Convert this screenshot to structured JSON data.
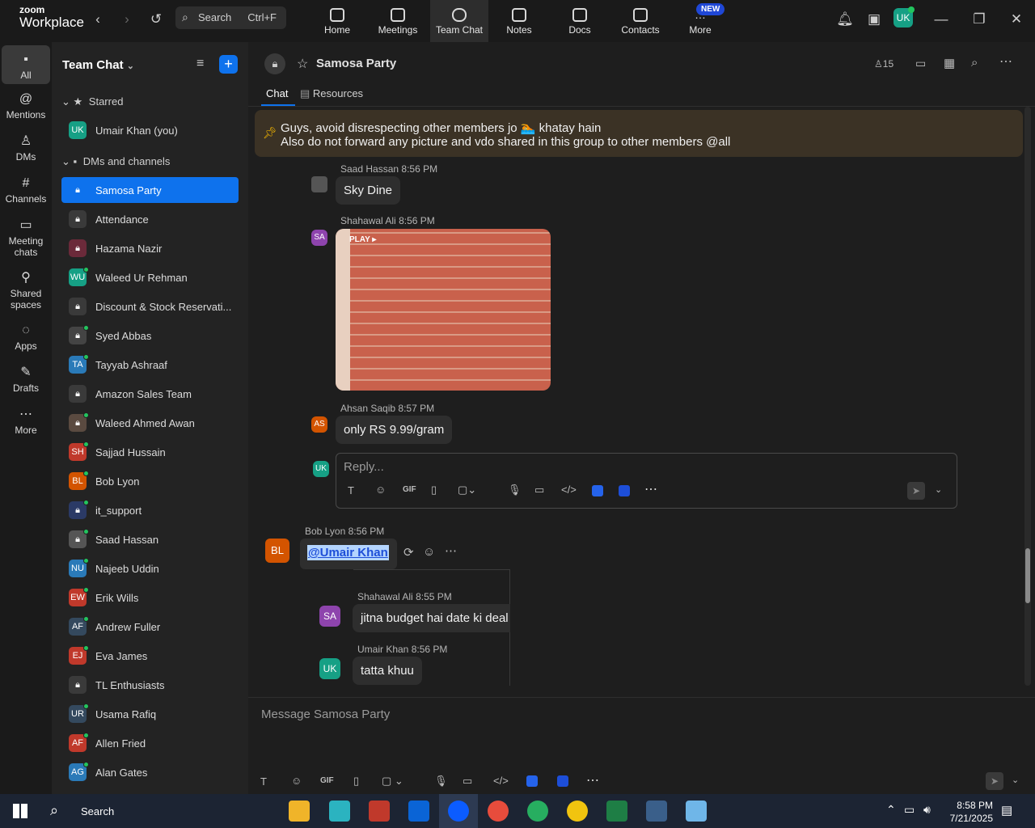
{
  "app": {
    "logo_top": "zoom",
    "logo_bottom": "Workplace"
  },
  "search": {
    "label": "Search",
    "shortcut": "Ctrl+F"
  },
  "nav": [
    {
      "label": "Home"
    },
    {
      "label": "Meetings"
    },
    {
      "label": "Team Chat"
    },
    {
      "label": "Notes"
    },
    {
      "label": "Docs"
    },
    {
      "label": "Contacts"
    },
    {
      "label": "More"
    }
  ],
  "new_badge": "NEW",
  "user_avatar": "UK",
  "rail": [
    {
      "label": "All"
    },
    {
      "label": "Mentions"
    },
    {
      "label": "DMs"
    },
    {
      "label": "Channels"
    },
    {
      "label": "Meeting chats"
    },
    {
      "label": "Shared spaces"
    },
    {
      "label": "Apps"
    },
    {
      "label": "Drafts"
    },
    {
      "label": "More"
    }
  ],
  "sidebar": {
    "title": "Team Chat",
    "starred_label": "Starred",
    "starred": [
      {
        "name": "Umair Khan (you)",
        "initials": "UK",
        "color": "#16a085"
      }
    ],
    "dms_label": "DMs and channels",
    "items": [
      {
        "name": "Samosa Party",
        "initials": "",
        "color": "#0e72ed"
      },
      {
        "name": "Attendance",
        "initials": "",
        "color": "#3a3a3a"
      },
      {
        "name": "Hazama Nazir",
        "initials": "",
        "color": "#6b2a3a"
      },
      {
        "name": "Waleed Ur Rehman",
        "initials": "WU",
        "color": "#16a085"
      },
      {
        "name": "Discount & Stock Reservati...",
        "initials": "",
        "color": "#3a3a3a"
      },
      {
        "name": "Syed Abbas",
        "initials": "",
        "color": "#444444"
      },
      {
        "name": "Tayyab Ashraaf",
        "initials": "TA",
        "color": "#2a7ab8"
      },
      {
        "name": "Amazon Sales Team",
        "initials": "",
        "color": "#3a3a3a"
      },
      {
        "name": "Waleed Ahmed Awan",
        "initials": "",
        "color": "#5a4a40"
      },
      {
        "name": "Sajjad Hussain",
        "initials": "SH",
        "color": "#c0392b"
      },
      {
        "name": "Bob Lyon",
        "initials": "BL",
        "color": "#d35400"
      },
      {
        "name": "it_support",
        "initials": "",
        "color": "#2b3a66"
      },
      {
        "name": "Saad Hassan",
        "initials": "",
        "color": "#555555"
      },
      {
        "name": "Najeeb Uddin",
        "initials": "NU",
        "color": "#2a7ab8"
      },
      {
        "name": "Erik Wills",
        "initials": "EW",
        "color": "#c0392b"
      },
      {
        "name": "Andrew Fuller",
        "initials": "AF",
        "color": "#34495e"
      },
      {
        "name": "Eva James",
        "initials": "EJ",
        "color": "#c0392b"
      },
      {
        "name": "TL Enthusiasts",
        "initials": "",
        "color": "#3a3a3a"
      },
      {
        "name": "Usama Rafiq",
        "initials": "UR",
        "color": "#34495e"
      },
      {
        "name": "Allen Fried",
        "initials": "AF",
        "color": "#c0392b"
      },
      {
        "name": "Alan Gates",
        "initials": "AG",
        "color": "#2a7ab8"
      }
    ]
  },
  "channel": {
    "title": "Samosa Party",
    "members": "15",
    "tabs": [
      {
        "label": "Chat"
      },
      {
        "label": "Resources"
      }
    ],
    "pinned_line1": "Guys, avoid disrespecting other members jo 🏊 khatay hain",
    "pinned_line2": "Also do not forward any picture and vdo shared in this group to other members @all"
  },
  "thread": [
    {
      "name": "Saad Hassan",
      "time": "8:56 PM",
      "text": "Sky Dine"
    },
    {
      "name": "Shahawal Ali",
      "time": "8:56 PM",
      "text": "PLAY",
      "initials": "SA"
    },
    {
      "name": "Ahsan Saqib",
      "time": "8:57 PM",
      "text": "only RS 9.99/gram",
      "initials": "AS"
    }
  ],
  "reply": {
    "placeholder": "Reply...",
    "initials": "UK"
  },
  "outer_msg": {
    "name": "Bob Lyon",
    "time": "8:56 PM",
    "initials": "BL",
    "text": "@Umair Khan",
    "quoted": [
      {
        "name": "Shahawal Ali",
        "time": "8:55 PM",
        "initials": "SA",
        "text": "jitna budget hai date ki deal"
      },
      {
        "name": "Umair Khan",
        "time": "8:56 PM",
        "initials": "UK",
        "text": "tatta khuu"
      }
    ]
  },
  "composer": {
    "placeholder": "Message Samosa Party"
  },
  "tools": {
    "gif": "GIF"
  },
  "taskbar": {
    "search": "Search",
    "time": "8:58 PM",
    "date": "7/21/2025"
  }
}
